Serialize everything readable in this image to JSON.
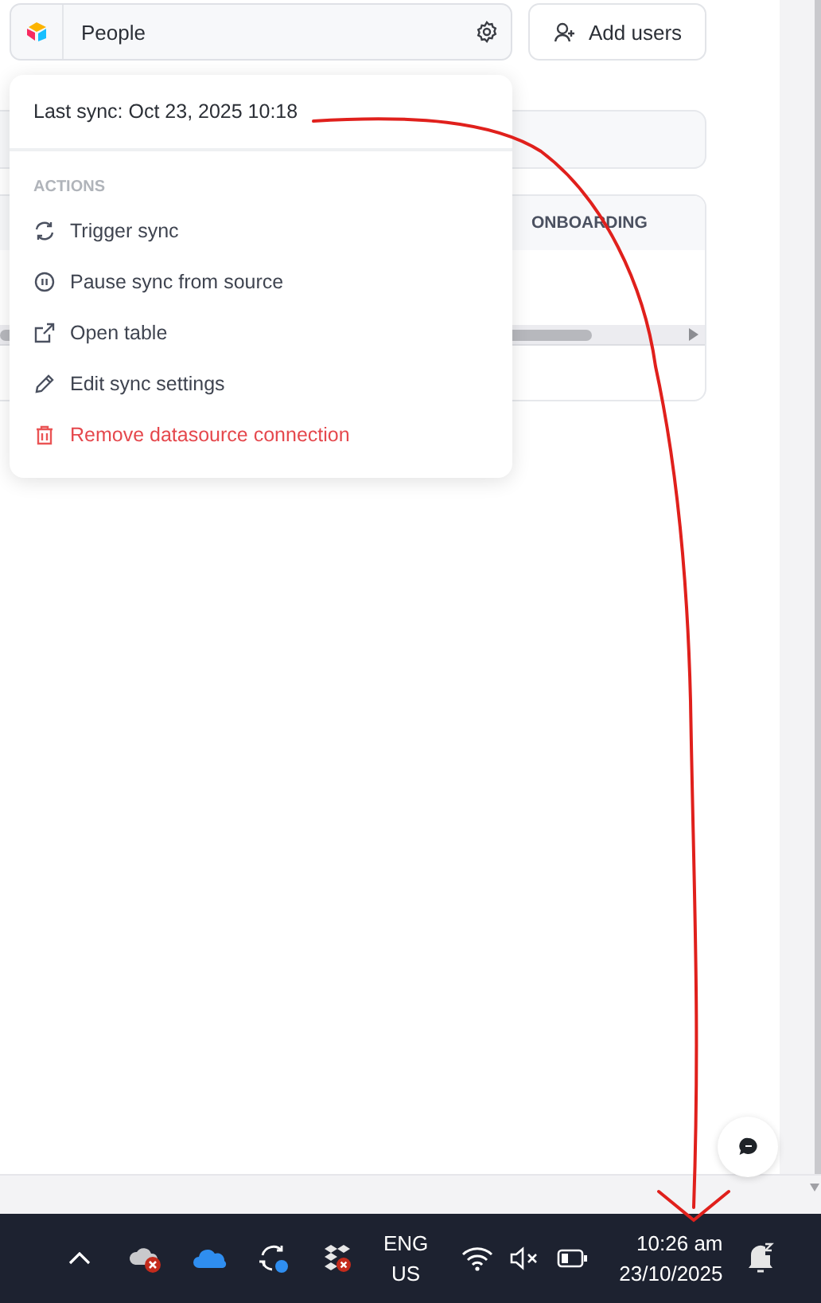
{
  "datasource": {
    "name": "People"
  },
  "add_users_button": {
    "label": "Add users"
  },
  "table": {
    "columns": [
      "ONBOARDING"
    ]
  },
  "sync_menu": {
    "last_sync": "Last sync: Oct 23, 2025 10:18",
    "section_label": "ACTIONS",
    "items": [
      {
        "label": "Trigger sync",
        "kind": "normal"
      },
      {
        "label": "Pause sync from source",
        "kind": "normal"
      },
      {
        "label": "Open table",
        "kind": "normal"
      },
      {
        "label": "Edit sync settings",
        "kind": "normal"
      },
      {
        "label": "Remove datasource connection",
        "kind": "danger"
      }
    ]
  },
  "taskbar": {
    "language": "ENG",
    "region": "US",
    "time": "10:26 am",
    "date": "23/10/2025"
  }
}
